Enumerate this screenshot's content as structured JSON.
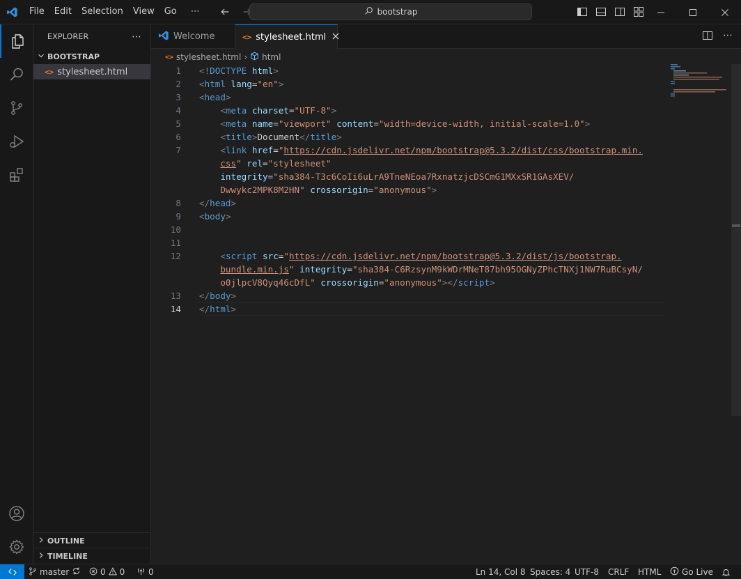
{
  "menu": [
    "File",
    "Edit",
    "Selection",
    "View",
    "Go",
    "⋯"
  ],
  "search": {
    "text": "bootstrap"
  },
  "sidebar": {
    "title": "EXPLORER",
    "folder": "BOOTSTRAP",
    "file": "stylesheet.html",
    "outline": "OUTLINE",
    "timeline": "TIMELINE"
  },
  "tabs": {
    "welcome": "Welcome",
    "active": "stylesheet.html"
  },
  "breadcrumb": {
    "file": "stylesheet.html",
    "symbol": "html"
  },
  "editor": {
    "line_numbers": [
      "1",
      "2",
      "3",
      "4",
      "5",
      "6",
      "7",
      "",
      "",
      "8",
      "9",
      "10",
      "11",
      "12",
      "",
      "",
      "13",
      "14"
    ],
    "current_line": "14"
  },
  "statusbar": {
    "branch": "master",
    "errors": "0",
    "warnings": "0",
    "ports": "0",
    "position": "Ln 14, Col 8",
    "spaces": "Spaces: 4",
    "encoding": "UTF-8",
    "eol": "CRLF",
    "language": "HTML",
    "golive": "Go Live"
  },
  "colors": {
    "accent": "#0078d4",
    "tag": "#569cd6",
    "attr": "#9cdcfe",
    "string": "#ce9178",
    "bg": "#1f1f1f"
  }
}
